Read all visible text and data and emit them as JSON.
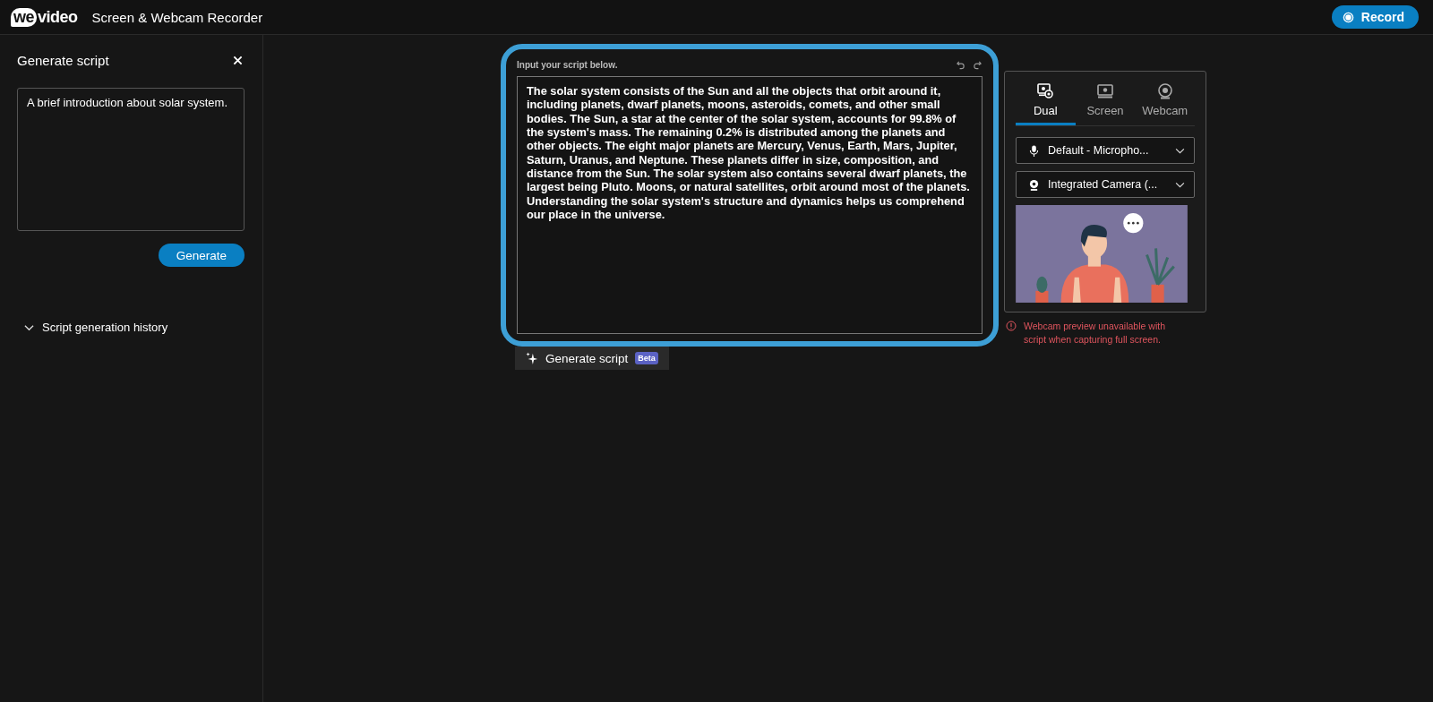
{
  "header": {
    "logo": {
      "badge": "we",
      "text": "video"
    },
    "title": "Screen & Webcam Recorder",
    "record_button": "Record"
  },
  "sidebar": {
    "title": "Generate script",
    "prompt": {
      "value": "A brief introduction about solar system."
    },
    "generate_button": "Generate",
    "history": {
      "label": "Script generation history",
      "expanded": false
    }
  },
  "editor": {
    "label": "Input your script below.",
    "script": "The solar system consists of the Sun and all the objects that orbit around it, including planets, dwarf planets, moons, asteroids, comets, and other small bodies. The Sun, a star at the center of the solar system, accounts for 99.8% of the system's mass. The remaining 0.2% is distributed among the planets and other objects. The eight major planets are Mercury, Venus, Earth, Mars, Jupiter, Saturn, Uranus, and Neptune. These planets differ in size, composition, and distance from the Sun. The solar system also contains several dwarf planets, the largest being Pluto. Moons, or natural satellites, orbit around most of the planets. Understanding the solar system's structure and dynamics helps us comprehend our place in the universe.",
    "generate_script": {
      "label": "Generate script",
      "badge": "Beta"
    }
  },
  "recorder": {
    "tabs": [
      {
        "label": "Dual",
        "kind": "dual",
        "selected": true
      },
      {
        "label": "Screen",
        "kind": "screen",
        "selected": false
      },
      {
        "label": "Webcam",
        "kind": "webcam",
        "selected": false
      }
    ],
    "devices": [
      {
        "kind": "microphone",
        "value": "Default - Micropho..."
      },
      {
        "kind": "camera",
        "value": "Integrated Camera (..."
      }
    ],
    "warning": "Webcam preview unavailable with script when capturing full screen."
  }
}
